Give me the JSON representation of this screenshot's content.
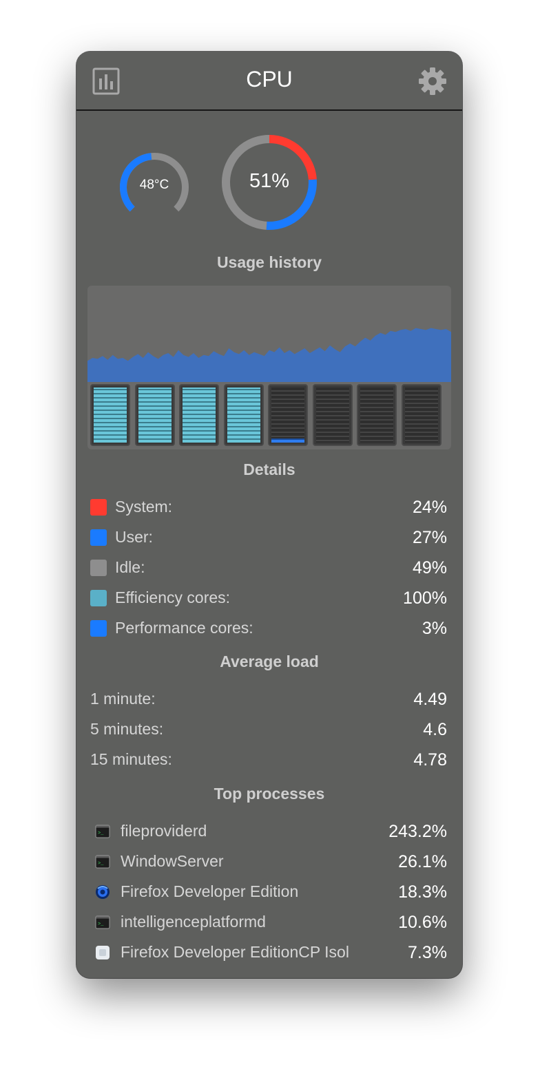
{
  "window": {
    "title": "CPU"
  },
  "gauges": {
    "temperature": {
      "text": "48°C",
      "fraction": 0.48
    },
    "usage": {
      "text": "51%",
      "system_pct": 24,
      "user_pct": 27,
      "idle_pct": 49
    }
  },
  "sections": {
    "usage_history": "Usage history",
    "details": "Details",
    "average_load": "Average load",
    "top_processes": "Top processes"
  },
  "colors": {
    "system": "#ff3b30",
    "user": "#1a7bff",
    "idle": "#8e8e8e",
    "efficiency": "#5ab0c8",
    "performance": "#1a7bff",
    "history_fill": "#3f70bd"
  },
  "usage_history": [
    0.22,
    0.25,
    0.24,
    0.27,
    0.23,
    0.28,
    0.24,
    0.25,
    0.22,
    0.26,
    0.29,
    0.25,
    0.31,
    0.27,
    0.24,
    0.28,
    0.3,
    0.26,
    0.33,
    0.28,
    0.26,
    0.3,
    0.25,
    0.28,
    0.27,
    0.32,
    0.29,
    0.27,
    0.35,
    0.31,
    0.29,
    0.33,
    0.28,
    0.31,
    0.29,
    0.27,
    0.33,
    0.31,
    0.36,
    0.3,
    0.33,
    0.29,
    0.32,
    0.35,
    0.3,
    0.33,
    0.36,
    0.32,
    0.38,
    0.34,
    0.31,
    0.37,
    0.4,
    0.37,
    0.42,
    0.46,
    0.43,
    0.48,
    0.51,
    0.49,
    0.53,
    0.52,
    0.54,
    0.55,
    0.53,
    0.56,
    0.55,
    0.54,
    0.56,
    0.55,
    0.54,
    0.55,
    0.52
  ],
  "cores": [
    {
      "type": "efficiency",
      "load": 1.0
    },
    {
      "type": "efficiency",
      "load": 1.0
    },
    {
      "type": "efficiency",
      "load": 1.0
    },
    {
      "type": "efficiency",
      "load": 1.0
    },
    {
      "type": "performance",
      "load": 0.08
    },
    {
      "type": "performance",
      "load": 0
    },
    {
      "type": "performance",
      "load": 0
    },
    {
      "type": "performance",
      "load": 0
    }
  ],
  "details": [
    {
      "label": "System:",
      "value": "24%",
      "color": "#ff3b30"
    },
    {
      "label": "User:",
      "value": "27%",
      "color": "#1a7bff"
    },
    {
      "label": "Idle:",
      "value": "49%",
      "color": "#8e8e8e"
    },
    {
      "label": "Efficiency cores:",
      "value": "100%",
      "color": "#5ab0c8"
    },
    {
      "label": "Performance cores:",
      "value": "3%",
      "color": "#1a7bff"
    }
  ],
  "average_load": [
    {
      "label": "1 minute:",
      "value": "4.49"
    },
    {
      "label": "5 minutes:",
      "value": "4.6"
    },
    {
      "label": "15 minutes:",
      "value": "4.78"
    }
  ],
  "processes": [
    {
      "name": "fileproviderd",
      "value": "243.2%",
      "icon": "terminal-icon"
    },
    {
      "name": "WindowServer",
      "value": "26.1%",
      "icon": "terminal-icon"
    },
    {
      "name": "Firefox Developer Edition",
      "value": "18.3%",
      "icon": "firefox-developer-icon"
    },
    {
      "name": "intelligenceplatformd",
      "value": "10.6%",
      "icon": "terminal-icon"
    },
    {
      "name": "Firefox Developer EditionCP Isol",
      "value": "7.3%",
      "icon": "generic-app-icon"
    }
  ]
}
